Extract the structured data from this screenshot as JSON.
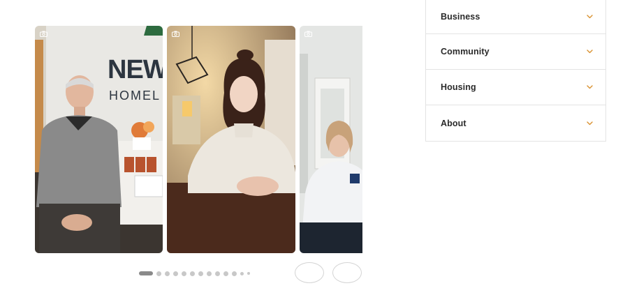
{
  "carousel": {
    "cards": [
      {
        "wall_sign_line1": "NEW",
        "wall_sign_line2": "HOMEL"
      },
      {},
      {}
    ],
    "pagination": {
      "count": 13,
      "active_index": 0
    },
    "prev_icon": "chevron-left-icon",
    "next_icon": "chevron-right-icon"
  },
  "accordion": {
    "items": [
      {
        "label": "Business"
      },
      {
        "label": "Community"
      },
      {
        "label": "Housing"
      },
      {
        "label": "About"
      }
    ],
    "chevron_color": "#d9912f"
  }
}
